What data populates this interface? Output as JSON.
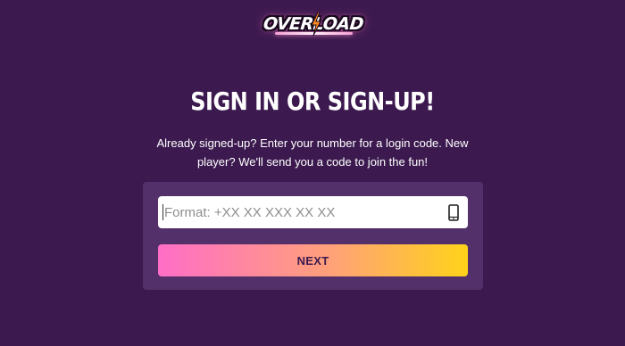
{
  "header": {
    "logo_text": "OVERLOAD"
  },
  "main": {
    "title": "SIGN IN OR SIGN-UP!",
    "subtitle": "Already signed-up? Enter your number for a login code. New player? We'll send you a code to join the fun!"
  },
  "form": {
    "phone_placeholder": "Format: +XX XX XXX XX XX",
    "phone_value": "",
    "phone_icon": "smartphone-icon",
    "next_label": "NEXT"
  },
  "colors": {
    "background": "#3c1a4f",
    "panel": "#54306a",
    "button_gradient_start": "#ff6ec7",
    "button_gradient_mid": "#ffa07a",
    "button_gradient_end": "#ffd31a",
    "button_text": "#3c1a4f"
  }
}
